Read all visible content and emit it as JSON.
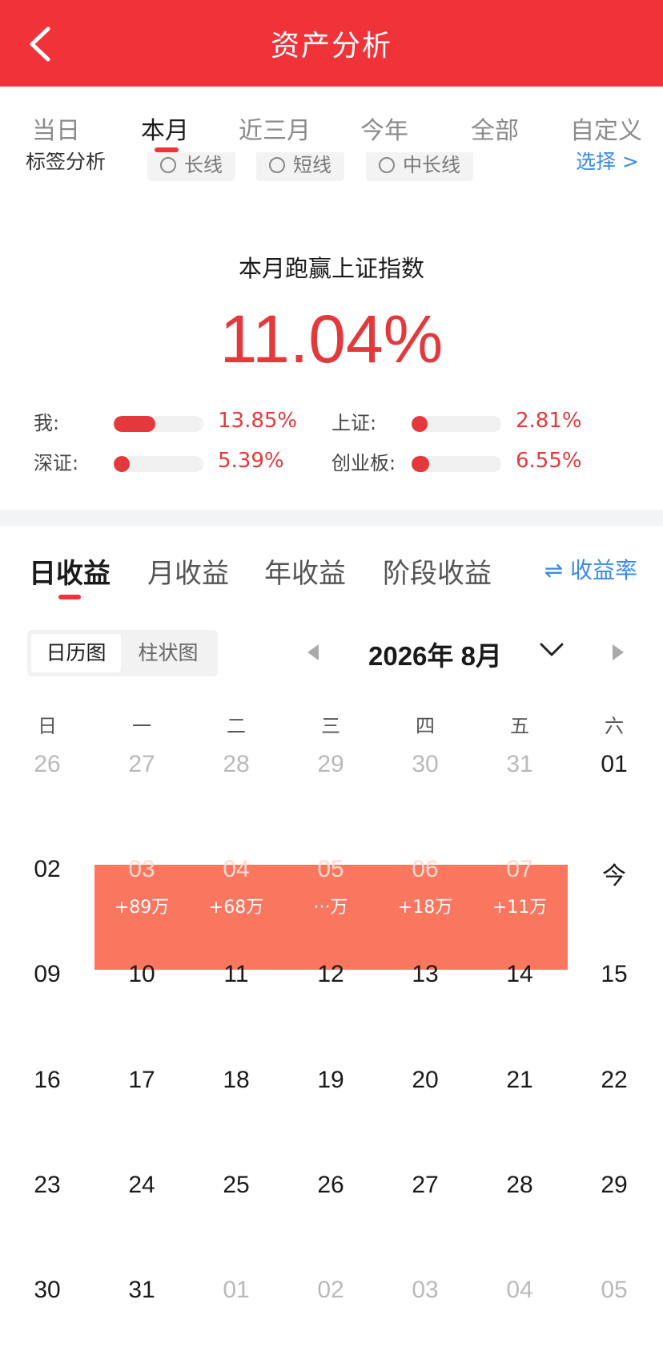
{
  "header": {
    "title": "资产分析"
  },
  "period_tabs": [
    "当日",
    "本月",
    "近三月",
    "今年",
    "全部",
    "自定义"
  ],
  "tags": {
    "label": "标签分析",
    "chips": [
      "长线",
      "短线",
      "中长线"
    ],
    "select": "选择 >"
  },
  "beat": {
    "title": "本月跑赢上证指数",
    "value": "11.04%"
  },
  "comparison": [
    {
      "label": "我:",
      "value": "13.85%",
      "fraction": 0.46
    },
    {
      "label": "上证:",
      "value": "2.81%",
      "fraction": 0.09
    },
    {
      "label": "深证:",
      "value": "5.39%",
      "fraction": 0.18
    },
    {
      "label": "创业板:",
      "value": "6.55%",
      "fraction": 0.2
    }
  ],
  "earn_tabs": [
    "日收益",
    "月收益",
    "年收益",
    "阶段收益"
  ],
  "rate_button": "⇌ 收益率",
  "view_toggle": [
    "日历图",
    "柱状图"
  ],
  "month": "2026年 8月",
  "weekdays": [
    "日",
    "一",
    "二",
    "三",
    "四",
    "五",
    "六"
  ],
  "calendar": [
    [
      {
        "d": "26",
        "m": true
      },
      {
        "d": "27",
        "m": true
      },
      {
        "d": "28",
        "m": true
      },
      {
        "d": "29",
        "m": true
      },
      {
        "d": "30",
        "m": true
      },
      {
        "d": "31",
        "m": true
      },
      {
        "d": "01"
      }
    ],
    [
      {
        "d": "02"
      },
      {
        "d": "03",
        "a": "+89万"
      },
      {
        "d": "04",
        "a": "+68万"
      },
      {
        "d": "05",
        "a": "···万"
      },
      {
        "d": "06",
        "a": "+18万"
      },
      {
        "d": "07",
        "a": "+11万"
      },
      {
        "d": "今"
      }
    ],
    [
      {
        "d": "09"
      },
      {
        "d": "10"
      },
      {
        "d": "11"
      },
      {
        "d": "12"
      },
      {
        "d": "13"
      },
      {
        "d": "14"
      },
      {
        "d": "15"
      }
    ],
    [
      {
        "d": "16"
      },
      {
        "d": "17"
      },
      {
        "d": "18"
      },
      {
        "d": "19"
      },
      {
        "d": "20"
      },
      {
        "d": "21"
      },
      {
        "d": "22"
      }
    ],
    [
      {
        "d": "23"
      },
      {
        "d": "24"
      },
      {
        "d": "25"
      },
      {
        "d": "26"
      },
      {
        "d": "27"
      },
      {
        "d": "28"
      },
      {
        "d": "29"
      }
    ],
    [
      {
        "d": "30"
      },
      {
        "d": "31"
      },
      {
        "d": "01",
        "m": true
      },
      {
        "d": "02",
        "m": true
      },
      {
        "d": "03",
        "m": true
      },
      {
        "d": "04",
        "m": true
      },
      {
        "d": "05",
        "m": true
      }
    ]
  ],
  "colors": {
    "brand_red": "#ef3339",
    "gain_red": "#e4393c",
    "highlight": "#f9765f",
    "link_blue": "#3a8ae6"
  }
}
